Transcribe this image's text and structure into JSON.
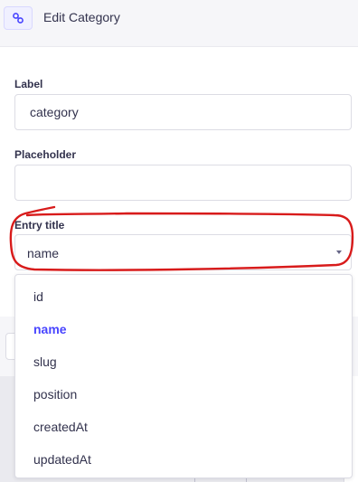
{
  "header": {
    "title": "Edit Category",
    "icon": "link-icon",
    "accent": "#4945ff"
  },
  "form": {
    "label": {
      "label": "Label",
      "value": "category"
    },
    "placeholder": {
      "label": "Placeholder",
      "value": ""
    },
    "entry_title": {
      "label": "Entry title",
      "value": "name"
    }
  },
  "dropdown": {
    "options": [
      "id",
      "name",
      "slug",
      "position",
      "createdAt",
      "updatedAt"
    ],
    "selected": "name"
  },
  "annotation": {
    "color": "#d81b1b"
  }
}
